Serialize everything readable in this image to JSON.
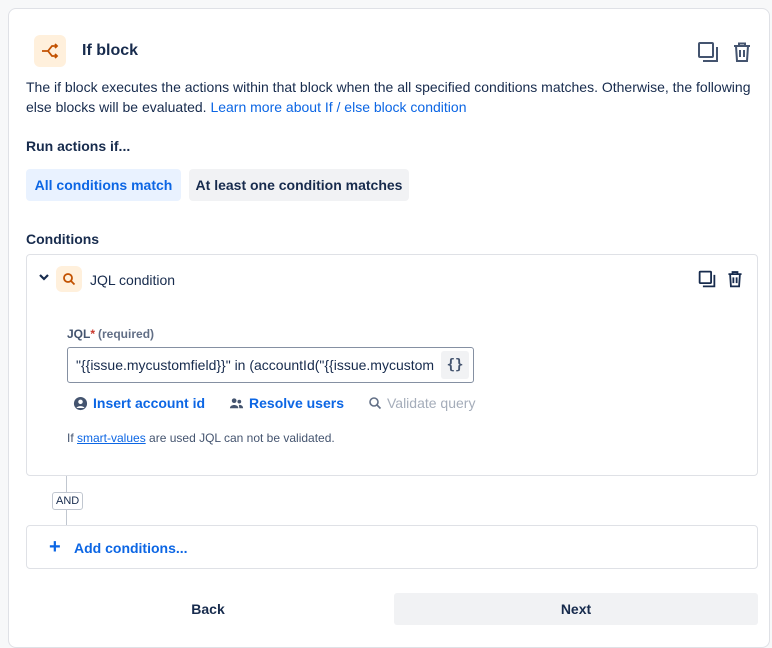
{
  "block": {
    "title": "If block",
    "description": "The if block executes the actions within that block when the all specified conditions matches. Otherwise, the following else blocks will be evaluated.",
    "learn_more": "Learn more about If / else block condition"
  },
  "run": {
    "label": "Run actions if...",
    "options": [
      "All conditions match",
      "At least one condition matches"
    ],
    "selected": "All conditions match"
  },
  "conditions": {
    "label": "Conditions",
    "items": [
      {
        "title": "JQL condition",
        "jql_label": "JQL",
        "required_marker": "*",
        "required_text": "(required)",
        "jql_value": "\"{{issue.mycustomfield}}\" in (accountId(\"{{issue.mycustomfield}}\"))",
        "smart_value_button": "{}",
        "actions": [
          "Insert account id",
          "Resolve users",
          "Validate query"
        ],
        "hint_prefix": "If",
        "hint_link": "smart-values",
        "hint_suffix": "are used JQL can not be validated."
      }
    ],
    "operator": "AND",
    "add_label": "Add conditions..."
  },
  "footer": {
    "back": "Back",
    "next": "Next"
  },
  "colors": {
    "accent": "#0c66e4",
    "icon_bg": "#fff0dc",
    "icon_fg": "#c25100"
  }
}
